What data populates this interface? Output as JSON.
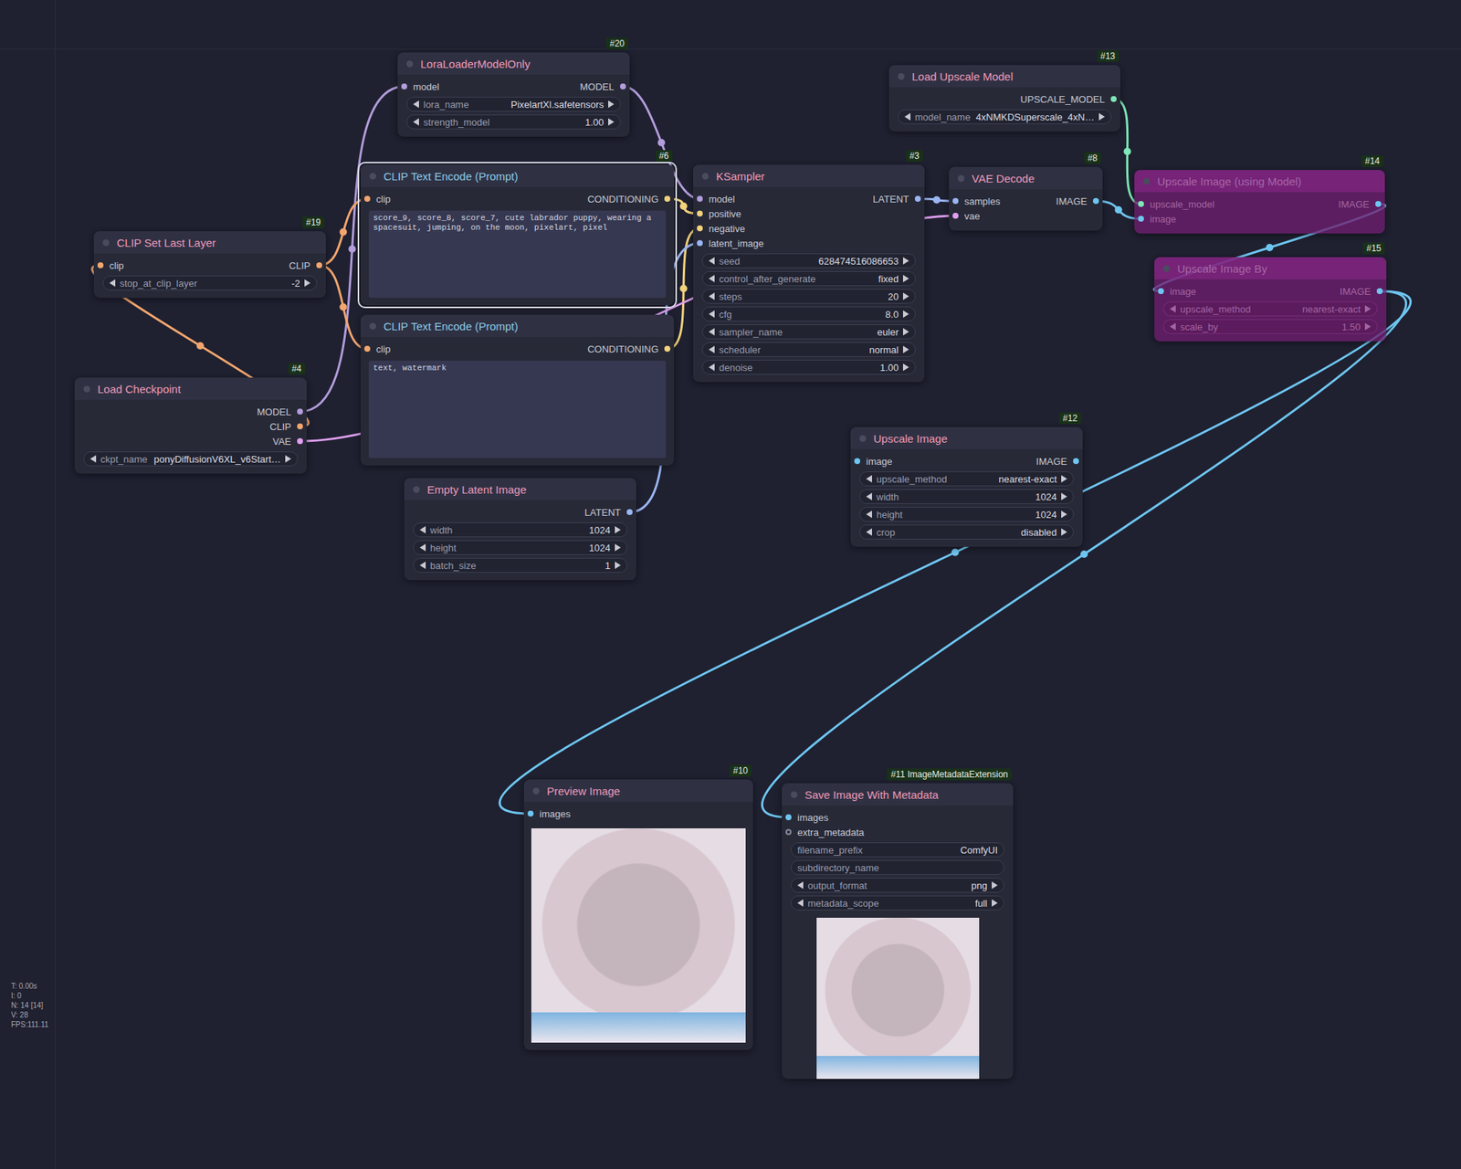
{
  "nodes": [
    {
      "badge": "#20",
      "title": "LoraLoaderModelOnly",
      "color": "#ef9ab8",
      "bypassed": false,
      "inputs": [
        {
          "name": "model",
          "color": "#b39ddb",
          "optional": false
        }
      ],
      "outputs": [
        {
          "name": "MODEL",
          "color": "#b39ddb"
        }
      ],
      "widgets": [
        {
          "label": "lora_name",
          "value": "PixelartXl.safetensors",
          "kind": "combo"
        },
        {
          "label": "strength_model",
          "value": "1.00",
          "kind": "number"
        }
      ]
    },
    {
      "badge": "#13",
      "title": "Load Upscale Model",
      "color": "#ef9ab8",
      "bypassed": false,
      "inputs": [],
      "outputs": [
        {
          "name": "UPSCALE_MODEL",
          "color": "#7ee8b8"
        }
      ],
      "widgets": [
        {
          "label": "model_name",
          "value": "4xNMKDSuperscale_4xN…",
          "kind": "combo"
        }
      ]
    },
    {
      "badge": "#6",
      "title": "CLIP Text Encode (Prompt)",
      "color": "#8ccbe8",
      "bypassed": false,
      "selected": true,
      "inputs": [
        {
          "name": "clip",
          "color": "#f2a66e",
          "optional": false
        }
      ],
      "outputs": [
        {
          "name": "CONDITIONING",
          "color": "#f3d27c"
        }
      ],
      "widgets": [],
      "text": "score_9, score_8, score_7, cute labrador puppy, wearing a spacesuit, jumping, on the moon, pixelart, pixel"
    },
    {
      "badge": "#3",
      "title": "KSampler",
      "color": "#ef9ab8",
      "bypassed": false,
      "inputs": [
        {
          "name": "model",
          "color": "#b39ddb",
          "optional": false
        },
        {
          "name": "positive",
          "color": "#f3d27c",
          "optional": false
        },
        {
          "name": "negative",
          "color": "#f3d27c",
          "optional": false
        },
        {
          "name": "latent_image",
          "color": "#9ab6f2",
          "optional": false
        }
      ],
      "outputs": [
        {
          "name": "LATENT",
          "color": "#9ab6f2"
        }
      ],
      "widgets": [
        {
          "label": "seed",
          "value": "628474516086653",
          "kind": "number"
        },
        {
          "label": "control_after_generate",
          "value": "fixed",
          "kind": "combo"
        },
        {
          "label": "steps",
          "value": "20",
          "kind": "number"
        },
        {
          "label": "cfg",
          "value": "8.0",
          "kind": "number"
        },
        {
          "label": "sampler_name",
          "value": "euler",
          "kind": "combo"
        },
        {
          "label": "scheduler",
          "value": "normal",
          "kind": "combo"
        },
        {
          "label": "denoise",
          "value": "1.00",
          "kind": "number"
        }
      ]
    },
    {
      "badge": "#8",
      "title": "VAE Decode",
      "color": "#ef9ab8",
      "bypassed": false,
      "inputs": [
        {
          "name": "samples",
          "color": "#9ab6f2",
          "optional": false
        },
        {
          "name": "vae",
          "color": "#e0a0f0",
          "optional": false
        }
      ],
      "outputs": [
        {
          "name": "IMAGE",
          "color": "#6ec6f0"
        }
      ],
      "widgets": []
    },
    {
      "badge": "#14",
      "title": "Upscale Image (using Model)",
      "color": "#ef9ab8",
      "bypassed": true,
      "inputs": [
        {
          "name": "upscale_model",
          "color": "#7ee8b8",
          "optional": false
        },
        {
          "name": "image",
          "color": "#6ec6f0",
          "optional": false
        }
      ],
      "outputs": [
        {
          "name": "IMAGE",
          "color": "#6ec6f0"
        }
      ],
      "widgets": []
    },
    {
      "badge": "#15",
      "title": "Upscale Image By",
      "color": "#ef9ab8",
      "bypassed": true,
      "inputs": [
        {
          "name": "image",
          "color": "#6ec6f0",
          "optional": false
        }
      ],
      "outputs": [
        {
          "name": "IMAGE",
          "color": "#6ec6f0"
        }
      ],
      "widgets": [
        {
          "label": "upscale_method",
          "value": "nearest-exact",
          "kind": "combo"
        },
        {
          "label": "scale_by",
          "value": "1.50",
          "kind": "number"
        }
      ]
    },
    {
      "badge": "#19",
      "title": "CLIP Set Last Layer",
      "color": "#ef9ab8",
      "bypassed": false,
      "inputs": [
        {
          "name": "clip",
          "color": "#f2a66e",
          "optional": false
        }
      ],
      "outputs": [
        {
          "name": "CLIP",
          "color": "#f2a66e"
        }
      ],
      "widgets": [
        {
          "label": "stop_at_clip_layer",
          "value": "-2",
          "kind": "number"
        }
      ]
    },
    {
      "title": "CLIP Text Encode (Prompt)",
      "color": "#8ccbe8",
      "bypassed": false,
      "inputs": [
        {
          "name": "clip",
          "color": "#f2a66e",
          "optional": false
        }
      ],
      "outputs": [
        {
          "name": "CONDITIONING",
          "color": "#f3d27c"
        }
      ],
      "widgets": [],
      "text": "text, watermark"
    },
    {
      "badge": "#4",
      "title": "Load Checkpoint",
      "color": "#ef9ab8",
      "bypassed": false,
      "inputs": [],
      "outputs": [
        {
          "name": "MODEL",
          "color": "#b39ddb"
        },
        {
          "name": "CLIP",
          "color": "#f2a66e"
        },
        {
          "name": "VAE",
          "color": "#e0a0f0"
        }
      ],
      "widgets": [
        {
          "label": "ckpt_name",
          "value": "ponyDiffusionV6XL_v6Start…",
          "kind": "combo"
        }
      ]
    },
    {
      "title": "Empty Latent Image",
      "color": "#ef9ab8",
      "bypassed": false,
      "inputs": [],
      "outputs": [
        {
          "name": "LATENT",
          "color": "#9ab6f2"
        }
      ],
      "widgets": [
        {
          "label": "width",
          "value": "1024",
          "kind": "number"
        },
        {
          "label": "height",
          "value": "1024",
          "kind": "number"
        },
        {
          "label": "batch_size",
          "value": "1",
          "kind": "number"
        }
      ]
    },
    {
      "badge": "#12",
      "title": "Upscale Image",
      "color": "#ef9ab8",
      "bypassed": false,
      "inputs": [
        {
          "name": "image",
          "color": "#6ec6f0",
          "optional": false
        }
      ],
      "outputs": [
        {
          "name": "IMAGE",
          "color": "#6ec6f0"
        }
      ],
      "widgets": [
        {
          "label": "upscale_method",
          "value": "nearest-exact",
          "kind": "combo"
        },
        {
          "label": "width",
          "value": "1024",
          "kind": "number"
        },
        {
          "label": "height",
          "value": "1024",
          "kind": "number"
        },
        {
          "label": "crop",
          "value": "disabled",
          "kind": "combo"
        }
      ]
    },
    {
      "badge": "#10",
      "title": "Preview Image",
      "color": "#ef9ab8",
      "bypassed": false,
      "inputs": [
        {
          "name": "images",
          "color": "#6ec6f0",
          "optional": false
        }
      ],
      "outputs": [],
      "widgets": [],
      "image": true
    },
    {
      "badge": "#11 ImageMetadataExtension",
      "title": "Save Image With Metadata",
      "color": "#ef9ab8",
      "bypassed": false,
      "inputs": [
        {
          "name": "images",
          "color": "#6ec6f0",
          "optional": false
        },
        {
          "name": "extra_metadata",
          "color": "#8a8c99",
          "optional": true
        }
      ],
      "outputs": [],
      "widgets": [
        {
          "label": "filename_prefix",
          "value": "ComfyUI",
          "kind": "text"
        },
        {
          "label": "subdirectory_name",
          "value": "",
          "kind": "text"
        },
        {
          "label": "output_format",
          "value": "png",
          "kind": "combo"
        },
        {
          "label": "metadata_scope",
          "value": "full",
          "kind": "combo"
        }
      ],
      "image": true
    }
  ],
  "links": [
    {
      "from": [
        9,
        0
      ],
      "to": [
        0,
        0
      ]
    },
    {
      "from": [
        0,
        0
      ],
      "to": [
        3,
        0
      ]
    },
    {
      "from": [
        9,
        1
      ],
      "to": [
        7,
        0
      ]
    },
    {
      "from": [
        7,
        0
      ],
      "to": [
        2,
        0
      ]
    },
    {
      "from": [
        7,
        0
      ],
      "to": [
        8,
        0
      ]
    },
    {
      "from": [
        2,
        0
      ],
      "to": [
        3,
        1
      ]
    },
    {
      "from": [
        8,
        0
      ],
      "to": [
        3,
        2
      ]
    },
    {
      "from": [
        10,
        0
      ],
      "to": [
        3,
        3
      ]
    },
    {
      "from": [
        3,
        0
      ],
      "to": [
        4,
        0
      ]
    },
    {
      "from": [
        9,
        2
      ],
      "to": [
        4,
        1
      ]
    },
    {
      "from": [
        1,
        0
      ],
      "to": [
        5,
        0
      ]
    },
    {
      "from": [
        4,
        0
      ],
      "to": [
        5,
        1
      ]
    },
    {
      "from": [
        5,
        0
      ],
      "to": [
        6,
        0
      ]
    },
    {
      "from": [
        6,
        0
      ],
      "to": [
        12,
        0
      ]
    },
    {
      "from": [
        6,
        0
      ],
      "to": [
        13,
        0
      ]
    }
  ],
  "stats": [
    "T: 0.00s",
    "I: 0",
    "N: 14 [14]",
    "V: 28",
    "FPS:111.11"
  ]
}
